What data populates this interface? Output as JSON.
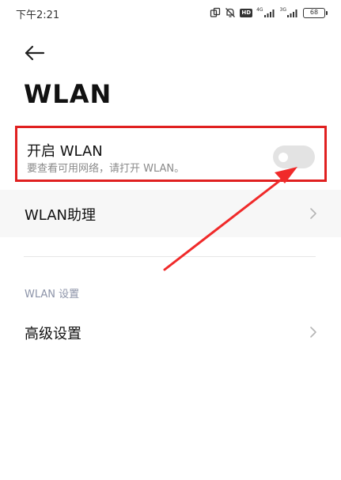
{
  "status_bar": {
    "time": "下午2:21",
    "network_badge": "HD",
    "signal_1_label": "4G",
    "signal_2_label": "3G",
    "battery": "68"
  },
  "header": {
    "title": "WLAN"
  },
  "wlan_toggle": {
    "label": "开启 WLAN",
    "hint": "要查看可用网络，请打开 WLAN。",
    "enabled": false
  },
  "rows": {
    "assistant_label": "WLAN助理",
    "section_header": "WLAN 设置",
    "advanced_label": "高级设置"
  },
  "colors": {
    "highlight_border": "#e02020",
    "annotation_arrow": "#f02a2a",
    "switch_off_track": "#e3e3e3",
    "section_header": "#8c93a8"
  },
  "icons": {
    "back": "arrow-left-icon",
    "chevron": "chevron-right-icon"
  }
}
